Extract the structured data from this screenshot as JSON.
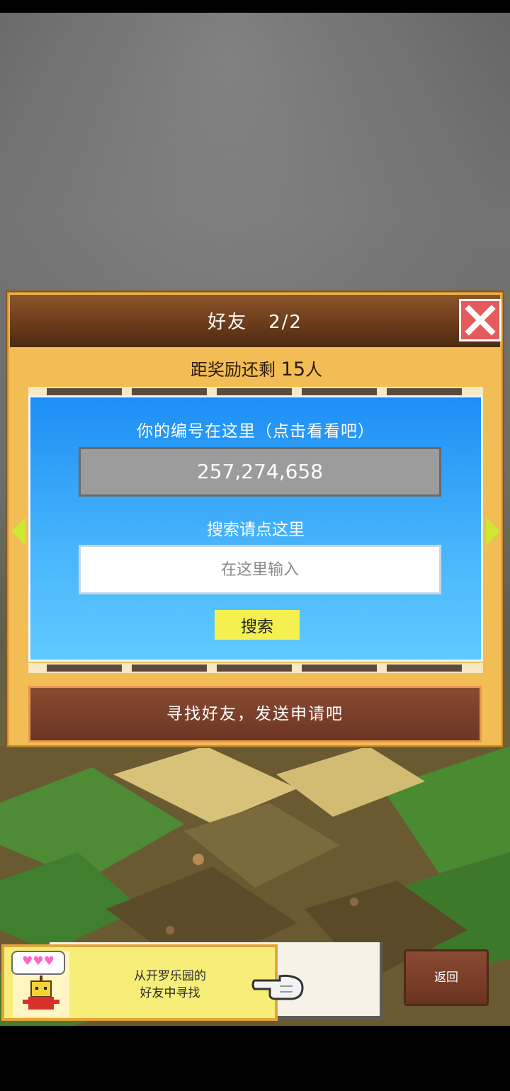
{
  "dialog": {
    "title": "好友",
    "page": "2/2",
    "reward_prefix": "距奖励还剩",
    "reward_count": "15",
    "reward_suffix": "人"
  },
  "panel": {
    "your_id_label": "你的编号在这里（点击看看吧）",
    "id_value": "257,274,658",
    "search_label": "搜索请点这里",
    "search_placeholder": "在这里输入",
    "search_button": "搜索"
  },
  "find_friends": "寻找好友，发送申请吧",
  "helper": {
    "hearts": "♥♥♥",
    "line1": "从开罗乐园的",
    "line2": "好友中寻找"
  },
  "back_button": "返回",
  "colors": {
    "panel_blue": "#1d8ef5",
    "dialog_gold": "#f3bd55",
    "search_yellow": "#f3f04f",
    "close_red": "#e55b5b"
  }
}
